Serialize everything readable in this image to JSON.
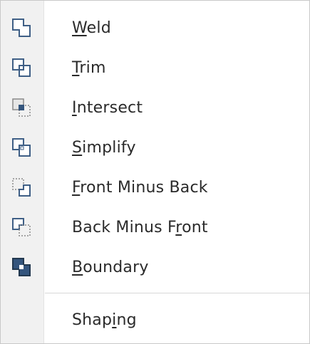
{
  "menu": {
    "items": [
      {
        "pre": "",
        "accel": "W",
        "post": "eld",
        "icon": "weld-icon"
      },
      {
        "pre": "",
        "accel": "T",
        "post": "rim",
        "icon": "trim-icon"
      },
      {
        "pre": "",
        "accel": "I",
        "post": "ntersect",
        "icon": "intersect-icon"
      },
      {
        "pre": "",
        "accel": "S",
        "post": "implify",
        "icon": "simplify-icon"
      },
      {
        "pre": "",
        "accel": "F",
        "post": "ront Minus Back",
        "icon": "front-minus-back-icon"
      },
      {
        "pre": "Back Minus F",
        "accel": "r",
        "post": "ont",
        "icon": "back-minus-front-icon"
      },
      {
        "pre": "",
        "accel": "B",
        "post": "oundary",
        "icon": "boundary-icon"
      }
    ],
    "footer": {
      "pre": "Shap",
      "accel": "i",
      "post": "ng"
    }
  },
  "colors": {
    "gutter": "#f1f1f1",
    "text": "#2a2a2a",
    "icon_stroke": "#3f5f86",
    "icon_fill_dark": "#34557d"
  }
}
